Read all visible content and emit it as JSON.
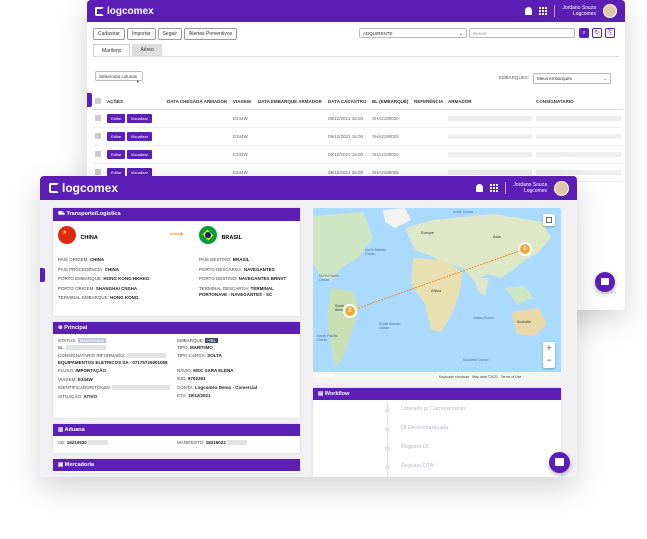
{
  "app": {
    "brand": "logcomex"
  },
  "user": {
    "name": "Jordano Souza",
    "company": "Logcomex"
  },
  "back": {
    "toolbar": {
      "cadastrar": "Cadastrar",
      "importar": "Importar",
      "seguir": "Seguir",
      "alertas": "Alertas Preventivos"
    },
    "filter_select": "ADQUIRENTE",
    "search_placeholder": "Buscar",
    "tabs": [
      "Marítimo",
      "Aéreo"
    ],
    "columns_select": "Selecionar colunas",
    "embarque_label": "EMBARQUES:",
    "embarque_select": "Meus embarques",
    "headers": [
      "AÇÕES",
      "DATA CHEGADA ARMADOR",
      "VIAGEM",
      "DATA EMBARQUE ARMADOR",
      "DATA CADASTRO",
      "BL (EMBARQUE)",
      "REFERÊNCIA",
      "ARMADOR",
      "CONSIGNATARIO"
    ],
    "edit_label": "Editar",
    "view_label": "Visualizar",
    "rows": [
      {
        "viagem": "E344W",
        "cadastro": "09/12/2021 16:00",
        "bl": "SHA2190030"
      },
      {
        "viagem": "E344W",
        "cadastro": "09/12/2021 16:00",
        "bl": "SHA2190023"
      },
      {
        "viagem": "E344W",
        "cadastro": "09/12/2021 16:00",
        "bl": "SHA2190020"
      },
      {
        "viagem": "E344W",
        "cadastro": "09/12/2021 16:00",
        "bl": "SHA2190005"
      }
    ]
  },
  "front": {
    "transporte": {
      "title": "Transporte/Logística",
      "origin_country": "CHINA",
      "dest_country": "BRASIL",
      "left": [
        {
          "k": "PAÍS ORIGEM:",
          "v": "CHINA"
        },
        {
          "k": "PAÍS PROCEDÊNCIA:",
          "v": "CHINA"
        },
        {
          "k": "PORTO EMBARQUE:",
          "v": "HONG KONG HKHKG"
        },
        {
          "k": "PORTO ORIGEM:",
          "v": "SHANGHAI CNSHA"
        },
        {
          "k": "TERMINAL EMBARQUE:",
          "v": "HONG KONG"
        }
      ],
      "right": [
        {
          "k": "PAÍS DESTINO:",
          "v": "BRASIL"
        },
        {
          "k": "PORTO DESCARGA:",
          "v": "NAVEGANTES"
        },
        {
          "k": "PORTO DESTINO:",
          "v": "NAVEGANTES BRNVT"
        },
        {
          "k": "TERMINAL DESCARGA:",
          "v": "TERMINAL PORTONAVE - NAVEGANTES - SC"
        }
      ]
    },
    "principal": {
      "title": "Principal",
      "status_label": "STATUS:",
      "status_badge": "Manifestado",
      "embarque_label": "EMBARQUE:",
      "embarque_badge": "HBL",
      "bl_label": "BL:",
      "tipo_label": "TIPO:",
      "tipo_value": "MARITIMO",
      "consignatario_label": "CONSIGNATARIO INFORMADO:",
      "consignatario_value": "EQUIPAMENTOS ELETRICOS SA - 07175725001058",
      "tipo_carga_label": "TIPO CARGA:",
      "tipo_carga_value": "SOLTA",
      "fluxo_label": "FLUXO:",
      "fluxo_value": "IMPORTAÇÃO",
      "navio_label": "NAVIO:",
      "navio_value": "MSC SARA ELENA",
      "viagem_label": "VIAGEM:",
      "viagem_value": "E344W",
      "imo_label": "IMO:",
      "imo_value": "9702261",
      "ident_label": "IDENTIFICADOR/TOKEN:",
      "conta_label": "CONTA:",
      "conta_value": "Logcomex Demo - Comercial",
      "situacao_label": "SITUAÇÃO:",
      "situacao_value": "ATIVO",
      "eta_label": "ETA:",
      "eta_value": "19/12/2021"
    },
    "aduana": {
      "title": "Aduana",
      "ce_label": "CE:",
      "ce_value": "18210530",
      "manifesto_label": "MANIFESTO:",
      "manifesto_value": "18215022"
    },
    "mercadoria": {
      "title": "Mercadoria"
    },
    "map": {
      "labels": [
        "Europe",
        "Africa",
        "Asia",
        "North Pacific Ocean",
        "South Pacific Ocean",
        "North Atlantic Ocean",
        "South Atlantic Ocean",
        "Indian Ocean",
        "South America",
        "Australia",
        "Southern Ocean",
        "Arctic Ocean"
      ],
      "marker1": "1",
      "marker2": "2",
      "attribution": "Keyboard shortcuts   Map data ©2022   Terms of Use",
      "google": "Google"
    },
    "workflow": {
      "title": "Workflow",
      "steps": [
        "Liberado p/ Carregamento",
        "DI Desembaraçada",
        "Registro DI",
        "Registro DTA"
      ]
    }
  }
}
